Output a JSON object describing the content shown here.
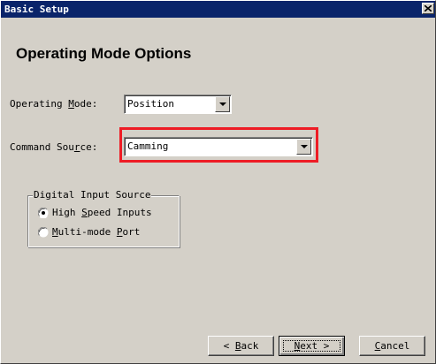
{
  "window": {
    "title": "Basic Setup",
    "close_icon": "close-icon"
  },
  "page": {
    "heading": "Operating Mode Options"
  },
  "operating_mode": {
    "label_pre": "Operating ",
    "label_mnemonic": "M",
    "label_post": "ode:",
    "value": "Position"
  },
  "command_source": {
    "label_pre": "Command Sou",
    "label_mnemonic": "r",
    "label_post": "ce:",
    "value": "Camming",
    "highlight_color": "#ee1c25"
  },
  "digital_input": {
    "legend": "Digital Input Source",
    "options": [
      {
        "pre": "High ",
        "mnemonic": "S",
        "post": "peed Inputs",
        "selected": true
      },
      {
        "pre": "",
        "mnemonic": "M",
        "post": "ulti-mode ",
        "mnemonic2": "P",
        "post2": "ort",
        "selected": false
      }
    ]
  },
  "buttons": {
    "back": {
      "pre": "< ",
      "mnemonic": "B",
      "post": "ack"
    },
    "next": {
      "pre": "",
      "mnemonic": "N",
      "post": "ext >"
    },
    "cancel": {
      "pre": "",
      "mnemonic": "C",
      "post": "ancel"
    }
  },
  "colors": {
    "titlebar": "#0a246a",
    "dialog_bg": "#d4d0c8"
  }
}
